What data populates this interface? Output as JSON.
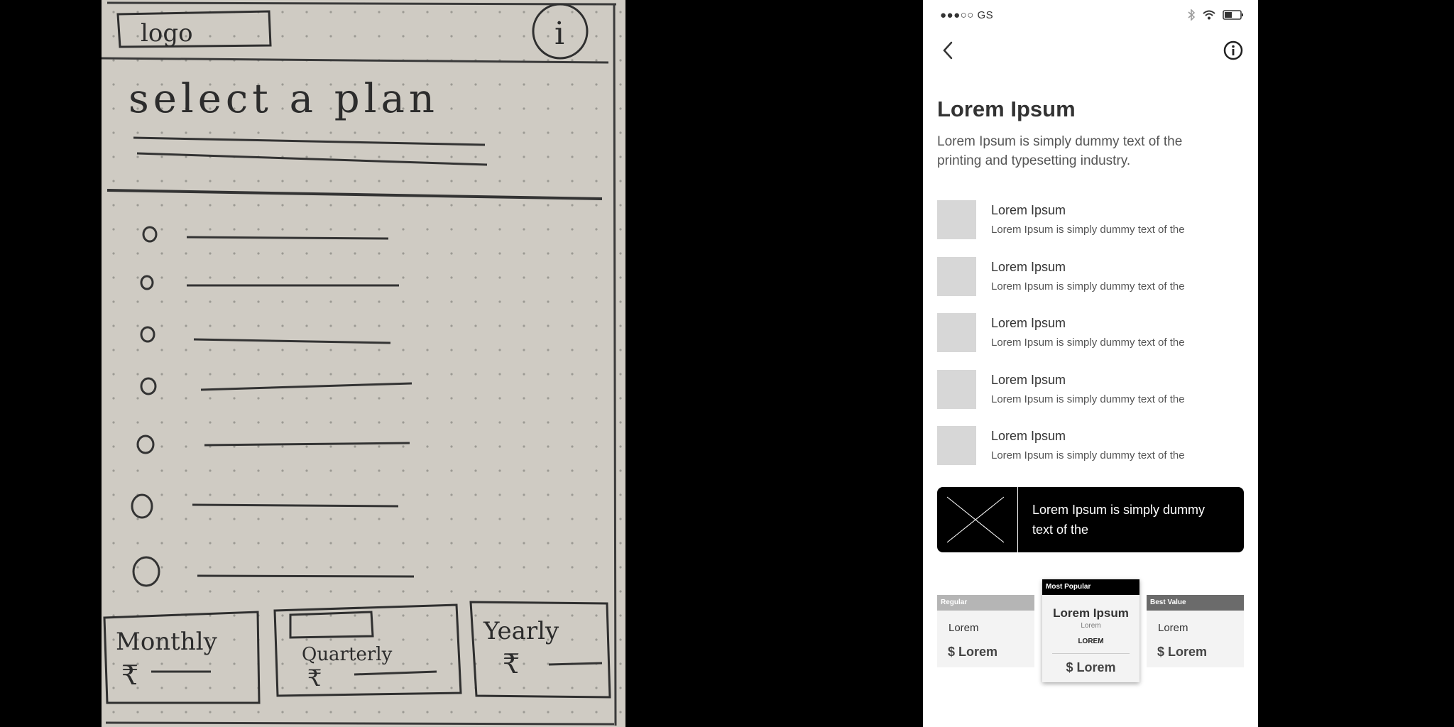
{
  "sketch": {
    "logo_text": "logo",
    "info_text": "i",
    "heading": "select a plan",
    "plans": [
      {
        "label": "Monthly",
        "price": "₹"
      },
      {
        "label": "Quarterly",
        "price": "₹"
      },
      {
        "label": "Yearly",
        "price": "₹"
      }
    ]
  },
  "status_bar": {
    "carrier": "●●●○○ GS"
  },
  "nav": {
    "back_icon": "chevron-left-icon",
    "info_icon": "info-circle-icon"
  },
  "header": {
    "title": "Lorem Ipsum",
    "subtitle": "Lorem Ipsum is simply dummy text of the printing and typesetting industry."
  },
  "features": [
    {
      "title": "Lorem Ipsum",
      "description": "Lorem Ipsum is simply dummy text of the"
    },
    {
      "title": "Lorem Ipsum",
      "description": "Lorem Ipsum is simply dummy text of the"
    },
    {
      "title": "Lorem Ipsum",
      "description": "Lorem Ipsum is simply dummy text of the"
    },
    {
      "title": "Lorem Ipsum",
      "description": "Lorem Ipsum is simply dummy text of the"
    },
    {
      "title": "Lorem Ipsum",
      "description": "Lorem Ipsum is simply dummy text of the"
    }
  ],
  "banner": {
    "text": "Lorem Ipsum is simply dummy text of the"
  },
  "plans": [
    {
      "tag": "Regular",
      "name": "Lorem",
      "price": "$ Lorem",
      "tag_color": "#b5b5b5"
    },
    {
      "tag": "Most Popular",
      "name": "Lorem Ipsum",
      "sub": "Lorem",
      "badge": "LOREM",
      "price": "$ Lorem",
      "tag_color": "#000000"
    },
    {
      "tag": "Best Value",
      "name": "Lorem",
      "price": "$ Lorem",
      "tag_color": "#6b6b6b"
    }
  ]
}
